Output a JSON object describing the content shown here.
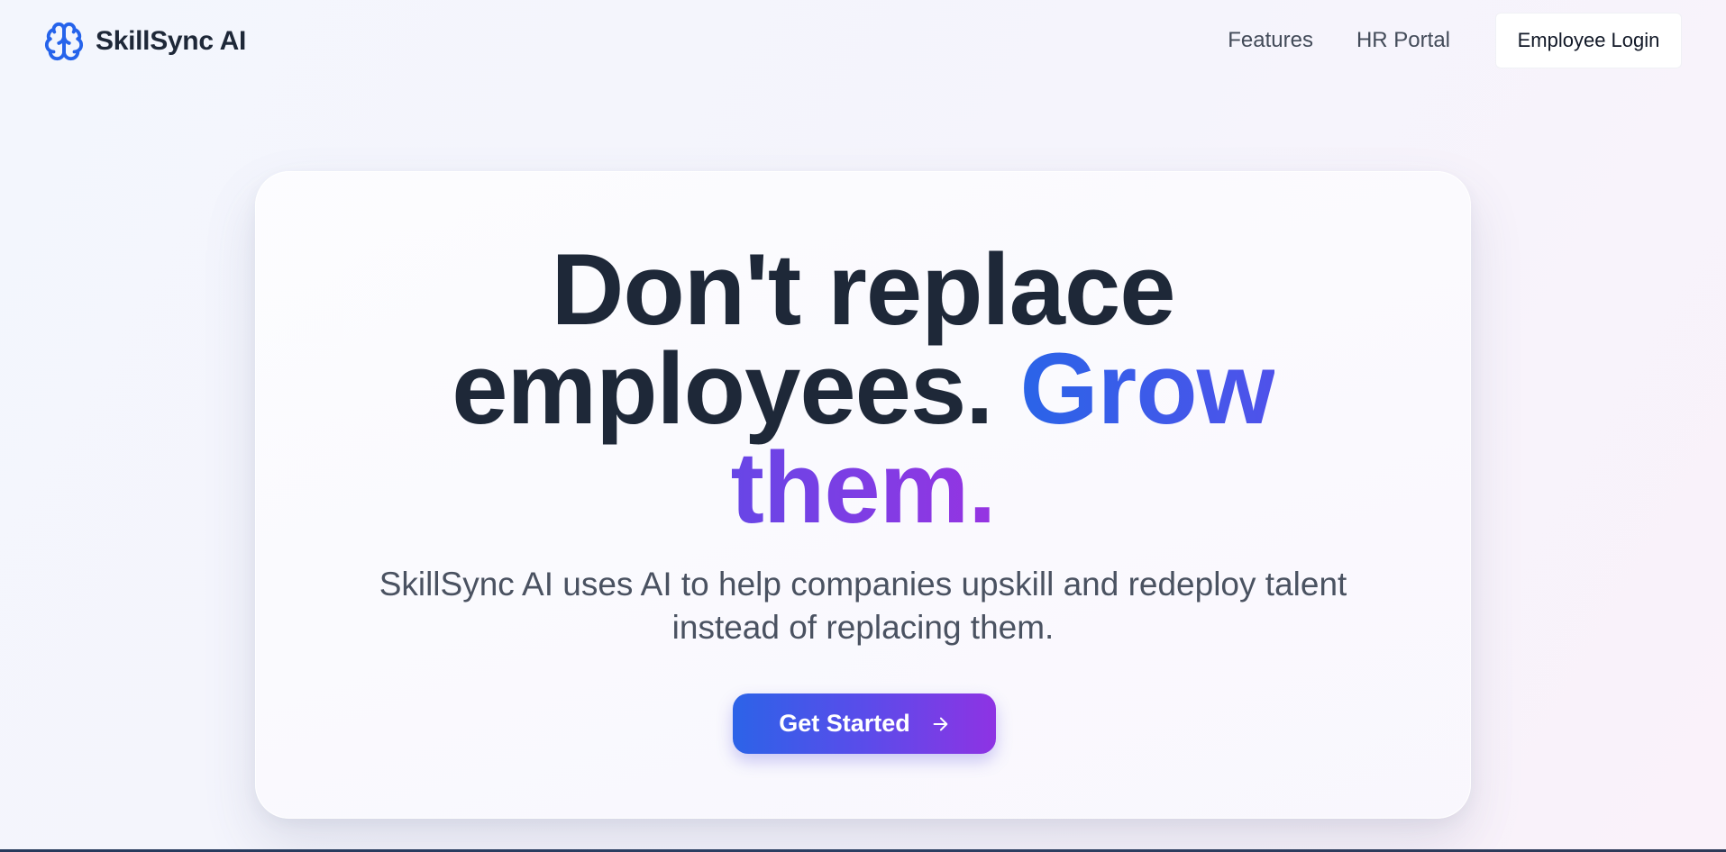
{
  "brand": {
    "name": "SkillSync AI",
    "icon": "brain-icon",
    "color": "#2563eb"
  },
  "nav": {
    "features": "Features",
    "hr_portal": "HR Portal",
    "login": "Employee Login"
  },
  "hero": {
    "headline_line1": "Don't replace",
    "headline_line2_plain": "employees.",
    "headline_line2_highlight": "Grow",
    "headline_line3_highlight": "them.",
    "subtitle_line1": "SkillSync AI uses AI to help companies upskill and redeploy talent",
    "subtitle_line2": "instead of replacing them.",
    "cta_label": "Get Started",
    "cta_icon": "arrow-right-icon"
  },
  "colors": {
    "heading": "#1e2838",
    "body_text": "#4a5261",
    "gradient_start": "#2563eb",
    "gradient_end": "#9333ea"
  }
}
